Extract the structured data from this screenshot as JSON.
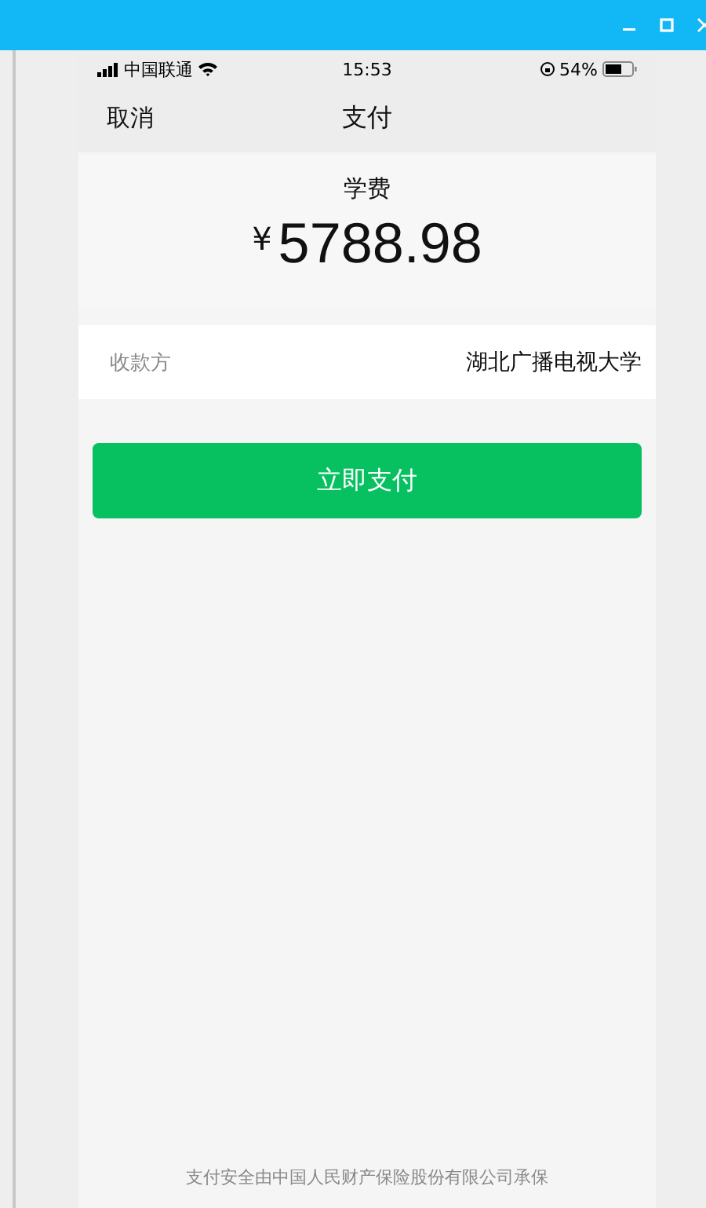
{
  "status_bar": {
    "carrier": "中国联通",
    "time": "15:53",
    "battery": "54%"
  },
  "nav": {
    "cancel": "取消",
    "title": "支付"
  },
  "payment": {
    "item": "学费",
    "currency": "¥",
    "amount": "5788.98"
  },
  "payee": {
    "label": "收款方",
    "value": "湖北广播电视大学"
  },
  "pay_button": "立即支付",
  "footer": "支付安全由中国人民财产保险股份有限公司承保"
}
